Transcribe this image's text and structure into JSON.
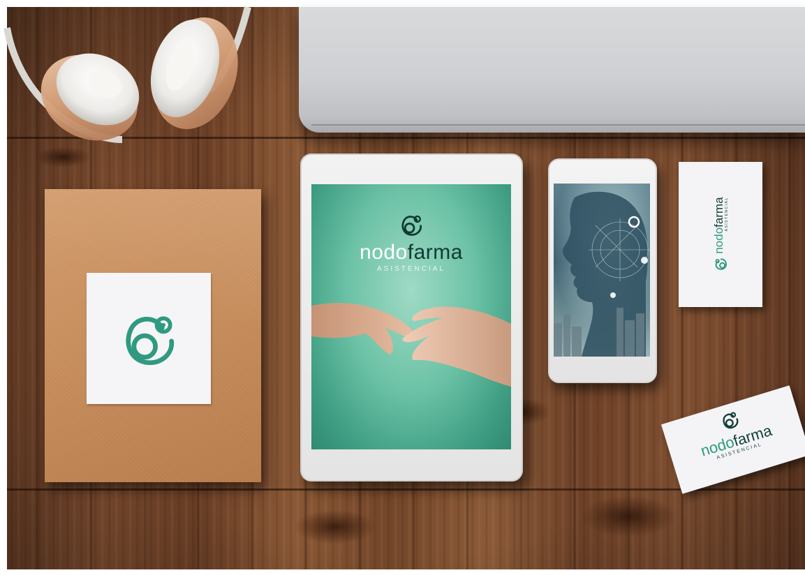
{
  "brand": {
    "word_part1": "nodo",
    "word_part2": "farma",
    "tagline": "ASISTENCIAL"
  },
  "colors": {
    "brand_teal": "#2f9a80",
    "brand_dark": "#13403a",
    "envelope_kraft": "#c88d5b",
    "tablet_screen_teal": "#6cc2a6"
  },
  "icons": {
    "logo_mark": "nodofarma-logo-mark"
  }
}
